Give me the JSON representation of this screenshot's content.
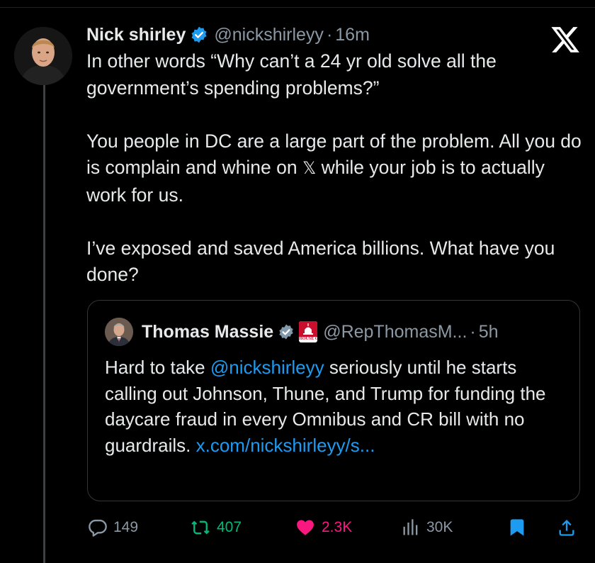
{
  "post": {
    "author_name": "Nick shirley",
    "handle": "@nickshirleyy",
    "separator": "·",
    "time": "16m",
    "text": {
      "line1": "In other words “Why can’t a 24 yr old solve all the",
      "line2": "government’s spending problems?”",
      "p2_before_x": "You people in DC are a large part of the problem. All you do is complain and whine on ",
      "p2_x_glyph": "𝕏",
      "p2_after_x": " while your job is to actually work for us.",
      "p3": "I’ve exposed and saved America billions. What have you done?"
    }
  },
  "quoted_post": {
    "author_name": "Thomas Massie",
    "handle": "@RepThomasM...",
    "separator": "·",
    "time": "5h",
    "badge_text": "HOUSE GOP",
    "text_before_mention": "Hard to take ",
    "mention": "@nickshirleyy",
    "text_after_mention": " seriously until he starts calling out Johnson, Thune, and Trump for funding the daycare fraud in every Omnibus and CR bill with no guardrails. ",
    "link_text": "x.com/nickshirleyy/s..."
  },
  "actions": {
    "replies": "149",
    "reposts": "407",
    "likes": "2.3K",
    "views": "30K"
  },
  "icons": {
    "reply": "reply-icon",
    "repost": "repost-icon",
    "like": "heart-icon",
    "views": "views-icon",
    "bookmark": "bookmark-icon",
    "share": "share-icon",
    "brand": "x-logo-icon",
    "verified": "verified-badge-icon"
  },
  "colors": {
    "background": "#000000",
    "text": "#e7e9ea",
    "muted": "#8b98a5",
    "link": "#1d9bf0",
    "repost": "#00ba7c",
    "like": "#f91880"
  }
}
